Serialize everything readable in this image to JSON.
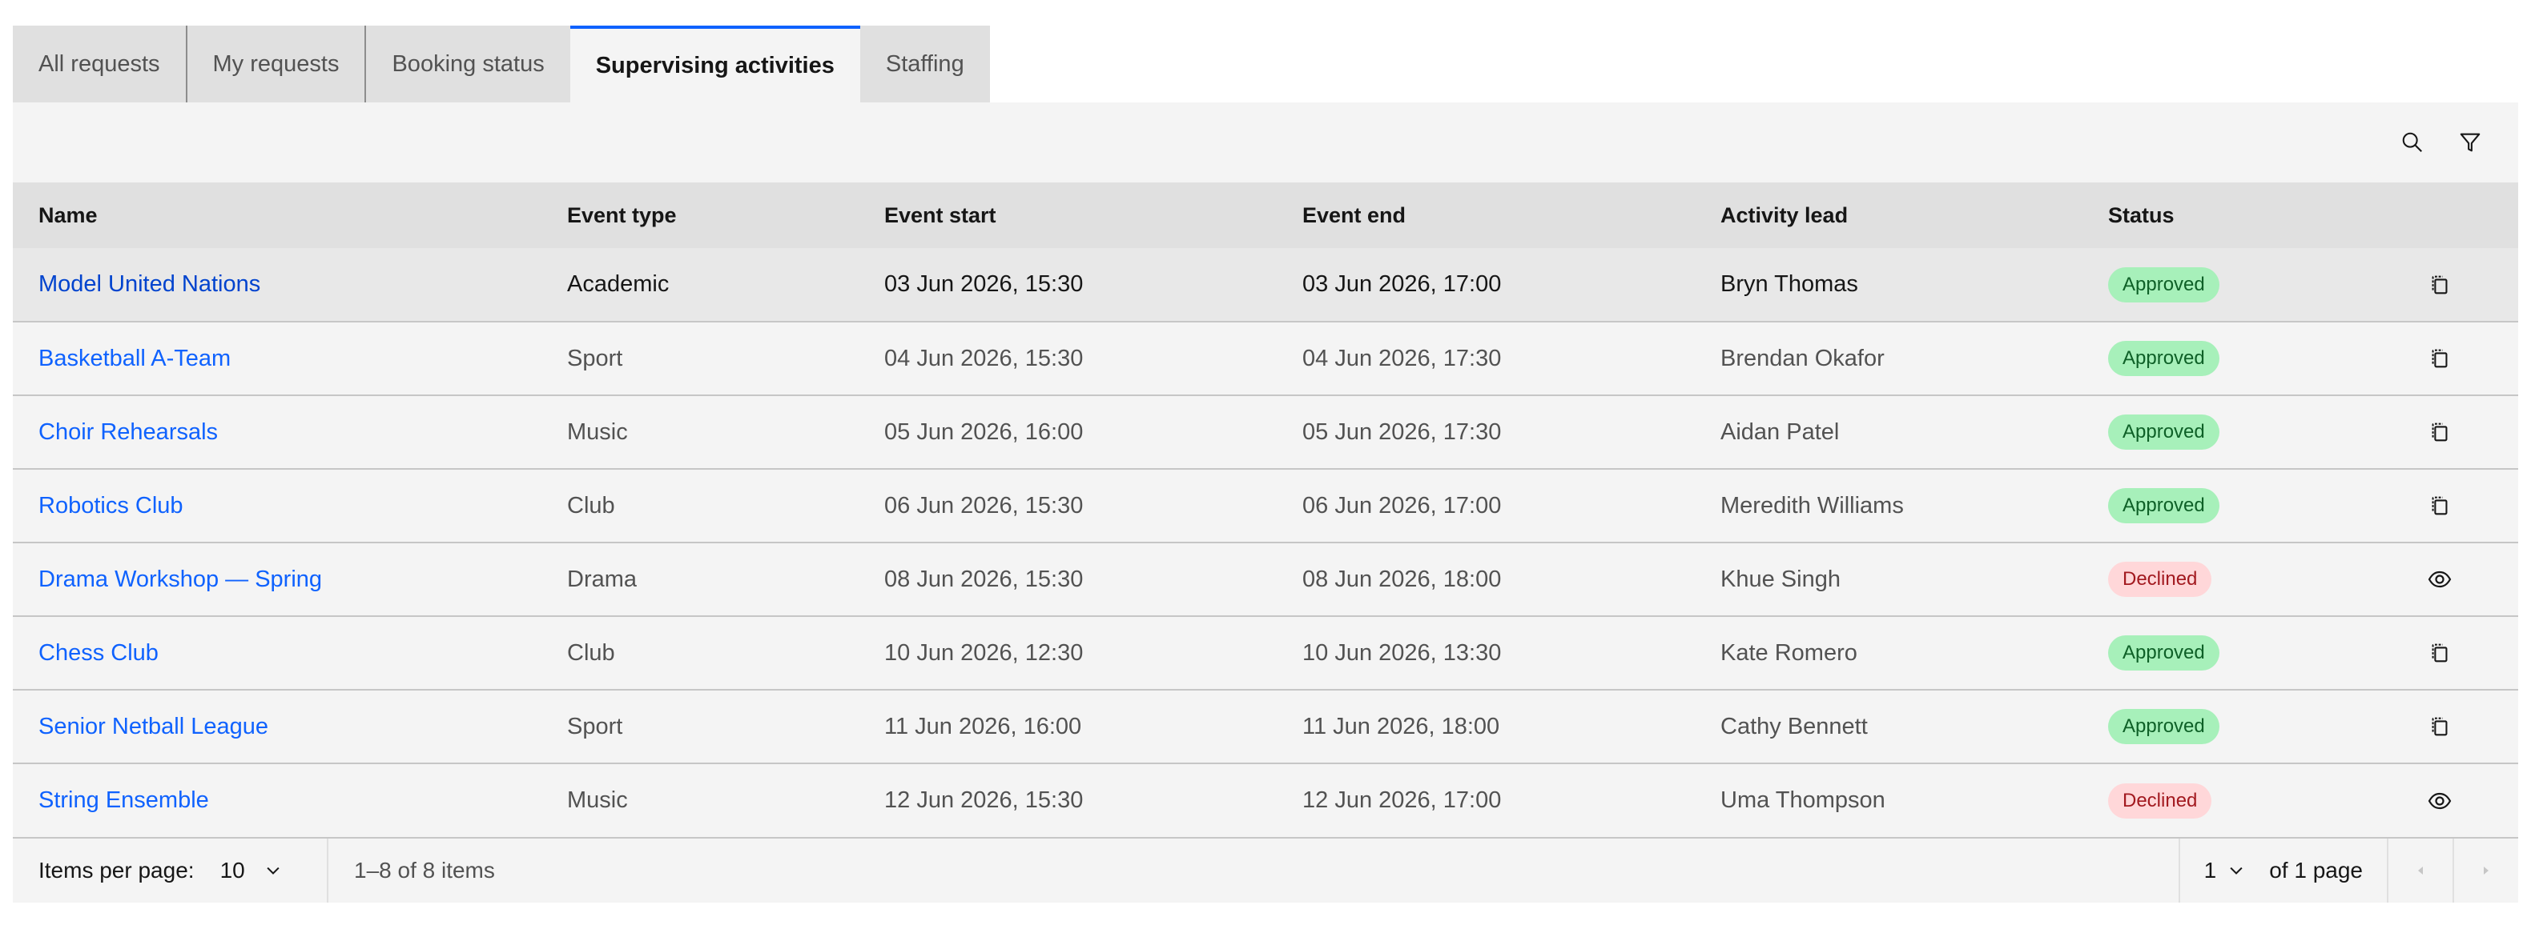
{
  "tabs": [
    {
      "label": "All requests",
      "active": false
    },
    {
      "label": "My requests",
      "active": false
    },
    {
      "label": "Booking status",
      "active": false
    },
    {
      "label": "Supervising activities",
      "active": true
    },
    {
      "label": "Staffing",
      "active": false
    }
  ],
  "toolbar": {
    "search_icon": "search-icon",
    "filter_icon": "filter-icon"
  },
  "columns": [
    "Name",
    "Event type",
    "Event start",
    "Event end",
    "Activity lead",
    "Status"
  ],
  "rows": [
    {
      "name": "Model United Nations",
      "type": "Academic",
      "start": "03 Jun 2026, 15:30",
      "end": "03 Jun 2026, 17:00",
      "lead": "Bryn Thomas",
      "status": "Approved",
      "action": "copy-icon"
    },
    {
      "name": "Basketball A-Team",
      "type": "Sport",
      "start": "04 Jun 2026, 15:30",
      "end": "04 Jun 2026, 17:30",
      "lead": "Brendan Okafor",
      "status": "Approved",
      "action": "copy-icon"
    },
    {
      "name": "Choir Rehearsals",
      "type": "Music",
      "start": "05 Jun 2026, 16:00",
      "end": "05 Jun 2026, 17:30",
      "lead": "Aidan Patel",
      "status": "Approved",
      "action": "copy-icon"
    },
    {
      "name": "Robotics Club",
      "type": "Club",
      "start": "06 Jun 2026, 15:30",
      "end": "06 Jun 2026, 17:00",
      "lead": "Meredith Williams",
      "status": "Approved",
      "action": "copy-icon"
    },
    {
      "name": "Drama Workshop — Spring",
      "type": "Drama",
      "start": "08 Jun 2026, 15:30",
      "end": "08 Jun 2026, 18:00",
      "lead": "Khue Singh",
      "status": "Declined",
      "action": "eye-icon"
    },
    {
      "name": "Chess Club",
      "type": "Club",
      "start": "10 Jun 2026, 12:30",
      "end": "10 Jun 2026, 13:30",
      "lead": "Kate Romero",
      "status": "Approved",
      "action": "copy-icon"
    },
    {
      "name": "Senior Netball League",
      "type": "Sport",
      "start": "11 Jun 2026, 16:00",
      "end": "11 Jun 2026, 18:00",
      "lead": "Cathy Bennett",
      "status": "Approved",
      "action": "copy-icon"
    },
    {
      "name": "String Ensemble",
      "type": "Music",
      "start": "12 Jun 2026, 15:30",
      "end": "12 Jun 2026, 17:00",
      "lead": "Uma Thompson",
      "status": "Declined",
      "action": "eye-icon"
    }
  ],
  "pagination": {
    "items_per_page_label": "Items per page:",
    "items_per_page_value": "10",
    "count_text": "1–8 of 8 items",
    "page_value": "1",
    "of_pages_text": "of 1 page"
  },
  "colors": {
    "accent": "#0f62fe",
    "approved_bg": "#a7f0ba",
    "declined_bg": "#ffd7d9"
  }
}
